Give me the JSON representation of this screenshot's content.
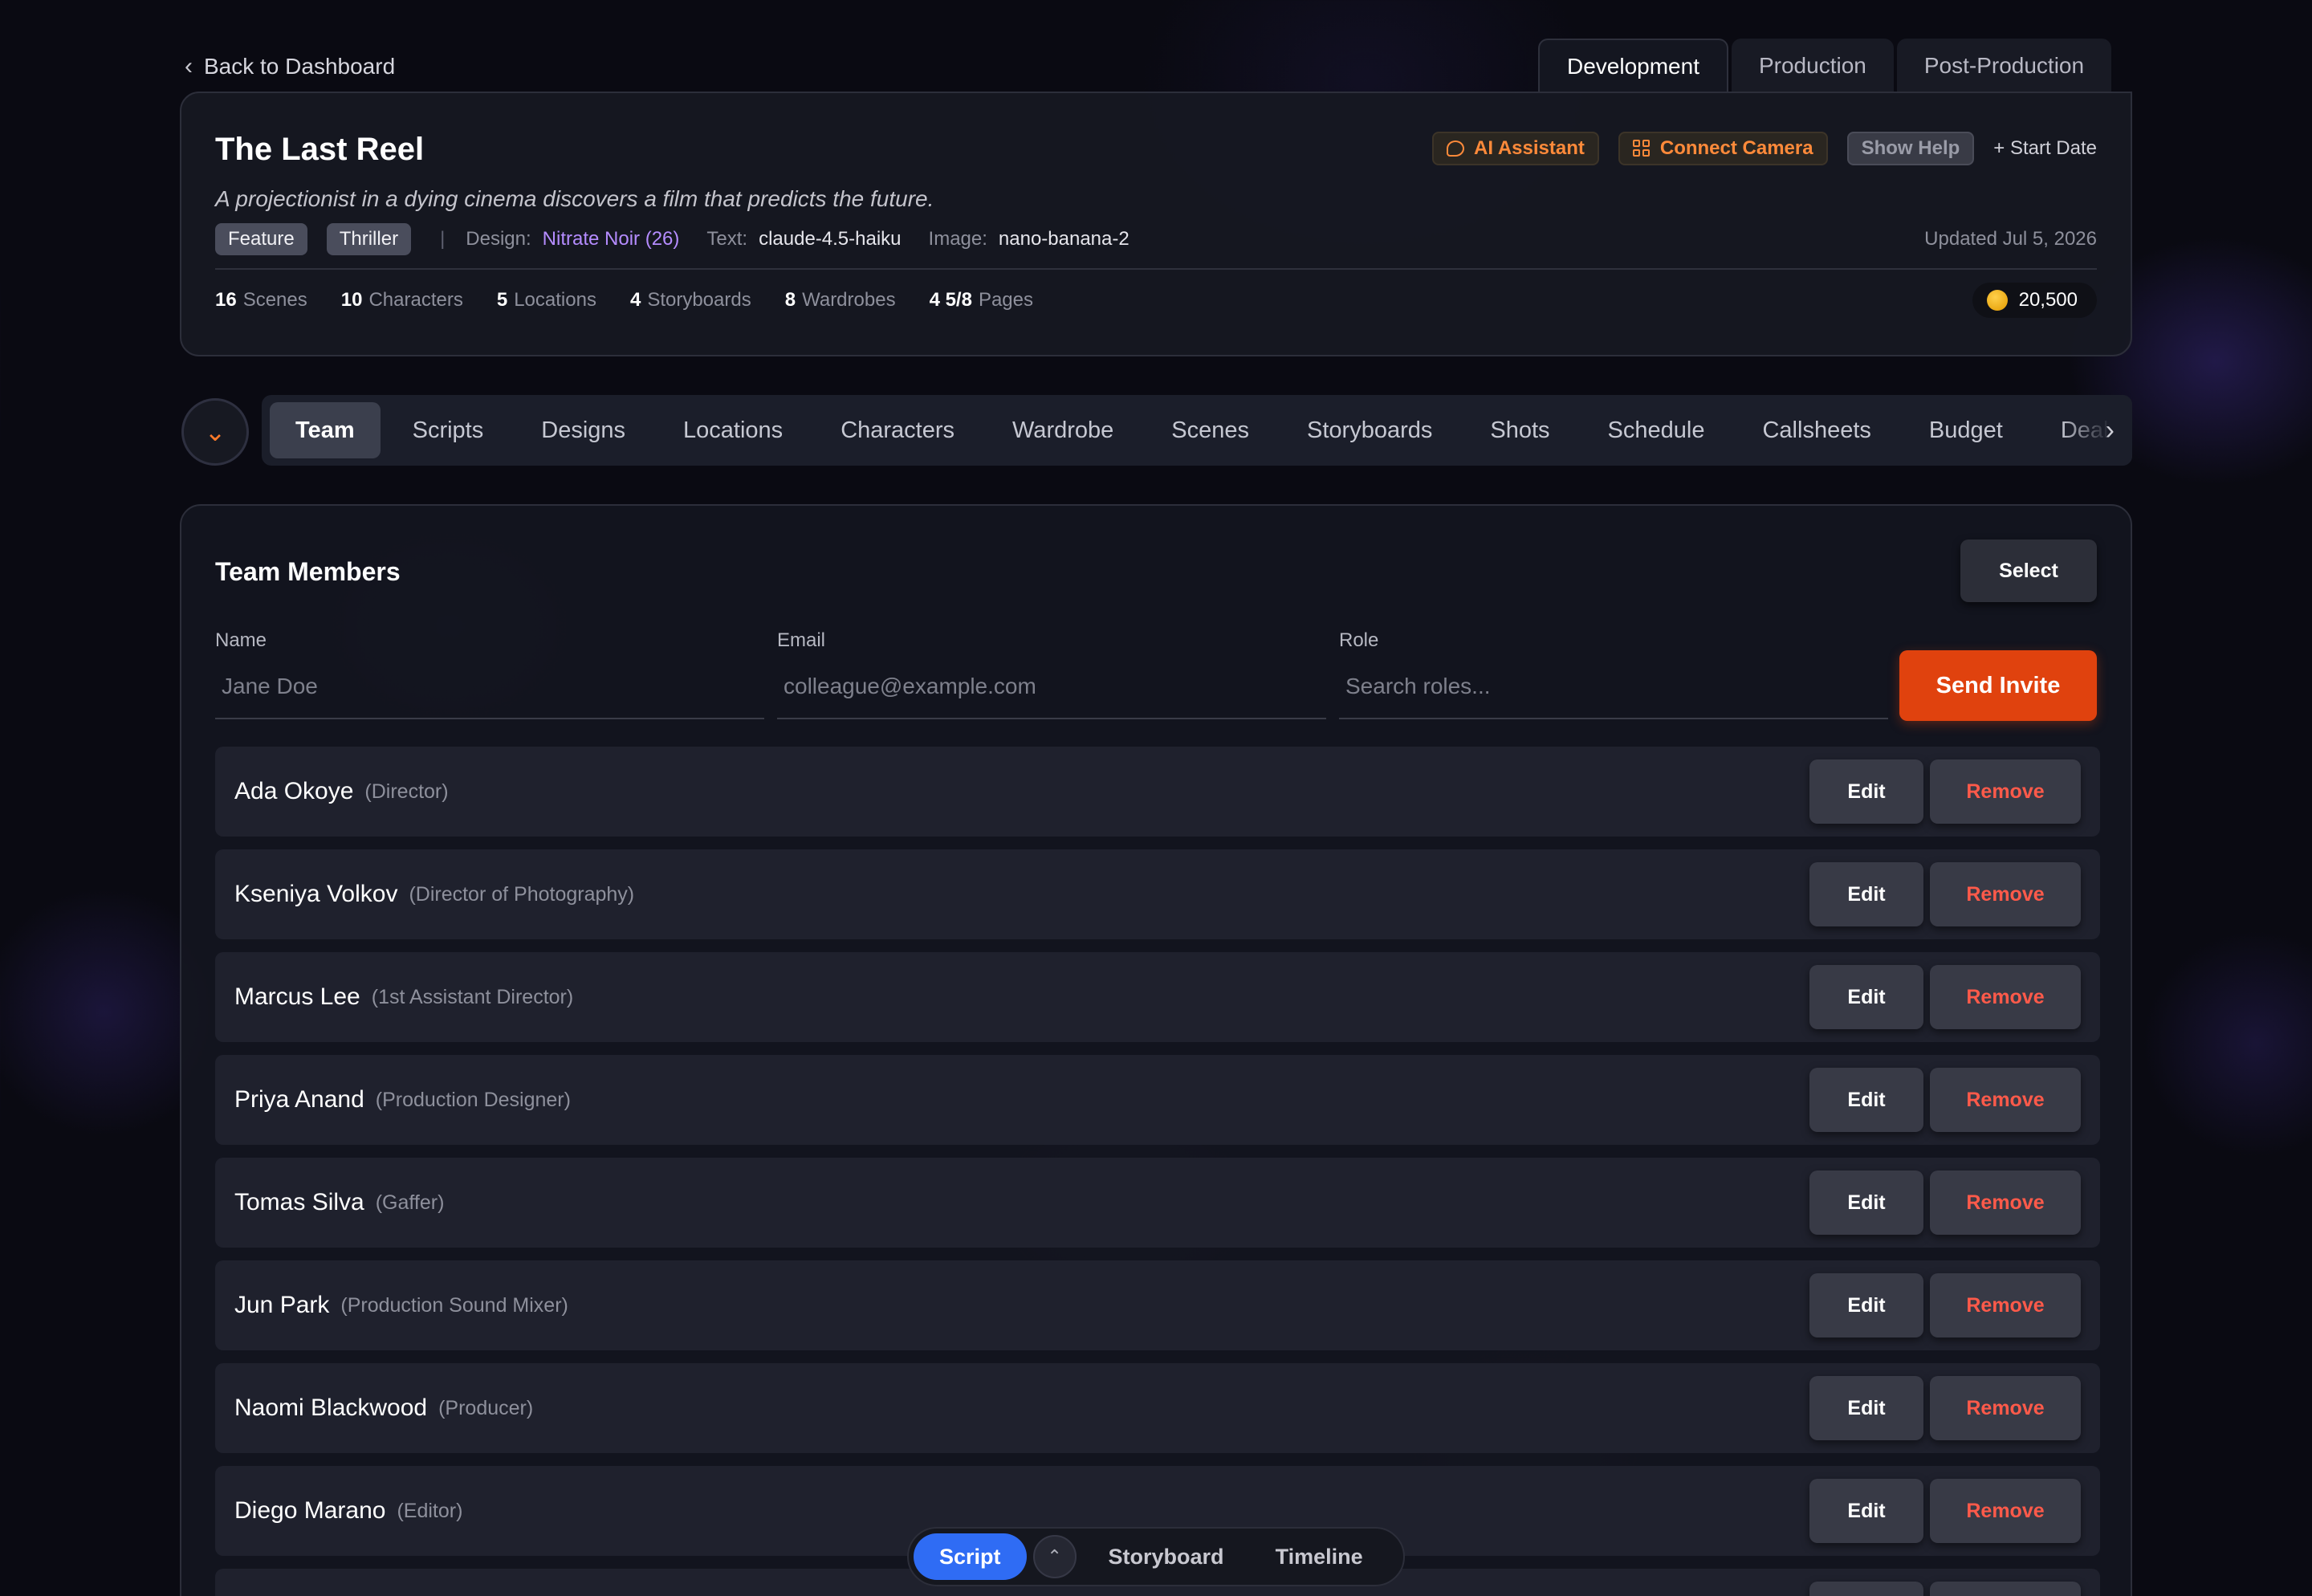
{
  "back": {
    "label": "Back to Dashboard"
  },
  "phase_tabs": [
    "Development",
    "Production",
    "Post-Production"
  ],
  "project": {
    "title": "The Last Reel",
    "logline": "A projectionist in a dying cinema discovers a film that predicts the future.",
    "tags": [
      "Feature",
      "Thriller"
    ],
    "separator": "|",
    "design_label": "Design:",
    "design_value": "Nitrate Noir (26)",
    "text_label": "Text:",
    "text_value": "claude-4.5-haiku",
    "image_label": "Image:",
    "image_value": "nano-banana-2",
    "updated": "Updated Jul 5, 2026",
    "actions": {
      "ai_assistant": "AI Assistant",
      "connect_camera": "Connect Camera",
      "show_help": "Show Help",
      "start_date": "+ Start Date"
    },
    "stats": [
      {
        "num": "16",
        "label": "Scenes"
      },
      {
        "num": "10",
        "label": "Characters"
      },
      {
        "num": "5",
        "label": "Locations"
      },
      {
        "num": "4",
        "label": "Storyboards"
      },
      {
        "num": "8",
        "label": "Wardrobes"
      },
      {
        "num": "4 5/8",
        "label": "Pages"
      }
    ],
    "credits": "20,500"
  },
  "section_tabs": [
    "Team",
    "Scripts",
    "Designs",
    "Locations",
    "Characters",
    "Wardrobe",
    "Scenes",
    "Storyboards",
    "Shots",
    "Schedule",
    "Callsheets",
    "Budget",
    "Deal"
  ],
  "team": {
    "title": "Team Members",
    "select_label": "Select",
    "fields": {
      "name_label": "Name",
      "name_placeholder": "Jane Doe",
      "email_label": "Email",
      "email_placeholder": "colleague@example.com",
      "role_label": "Role",
      "role_placeholder": "Search roles..."
    },
    "send_invite": "Send Invite",
    "edit_label": "Edit",
    "remove_label": "Remove",
    "members": [
      {
        "name": "Ada Okoye",
        "role": "(Director)"
      },
      {
        "name": "Kseniya Volkov",
        "role": "(Director of Photography)"
      },
      {
        "name": "Marcus Lee",
        "role": "(1st Assistant Director)"
      },
      {
        "name": "Priya Anand",
        "role": "(Production Designer)"
      },
      {
        "name": "Tomas Silva",
        "role": "(Gaffer)"
      },
      {
        "name": "Jun Park",
        "role": "(Production Sound Mixer)"
      },
      {
        "name": "Naomi Blackwood",
        "role": "(Producer)"
      },
      {
        "name": "Diego Marano",
        "role": "(Editor)"
      }
    ]
  },
  "dock": {
    "tabs": [
      "Script",
      "Storyboard",
      "Timeline"
    ]
  },
  "colors": {
    "accent_orange": "#e0420e",
    "dock_active": "#2f6cf4",
    "design_purple": "#b58cff",
    "remove_red": "#ff5a4a"
  }
}
